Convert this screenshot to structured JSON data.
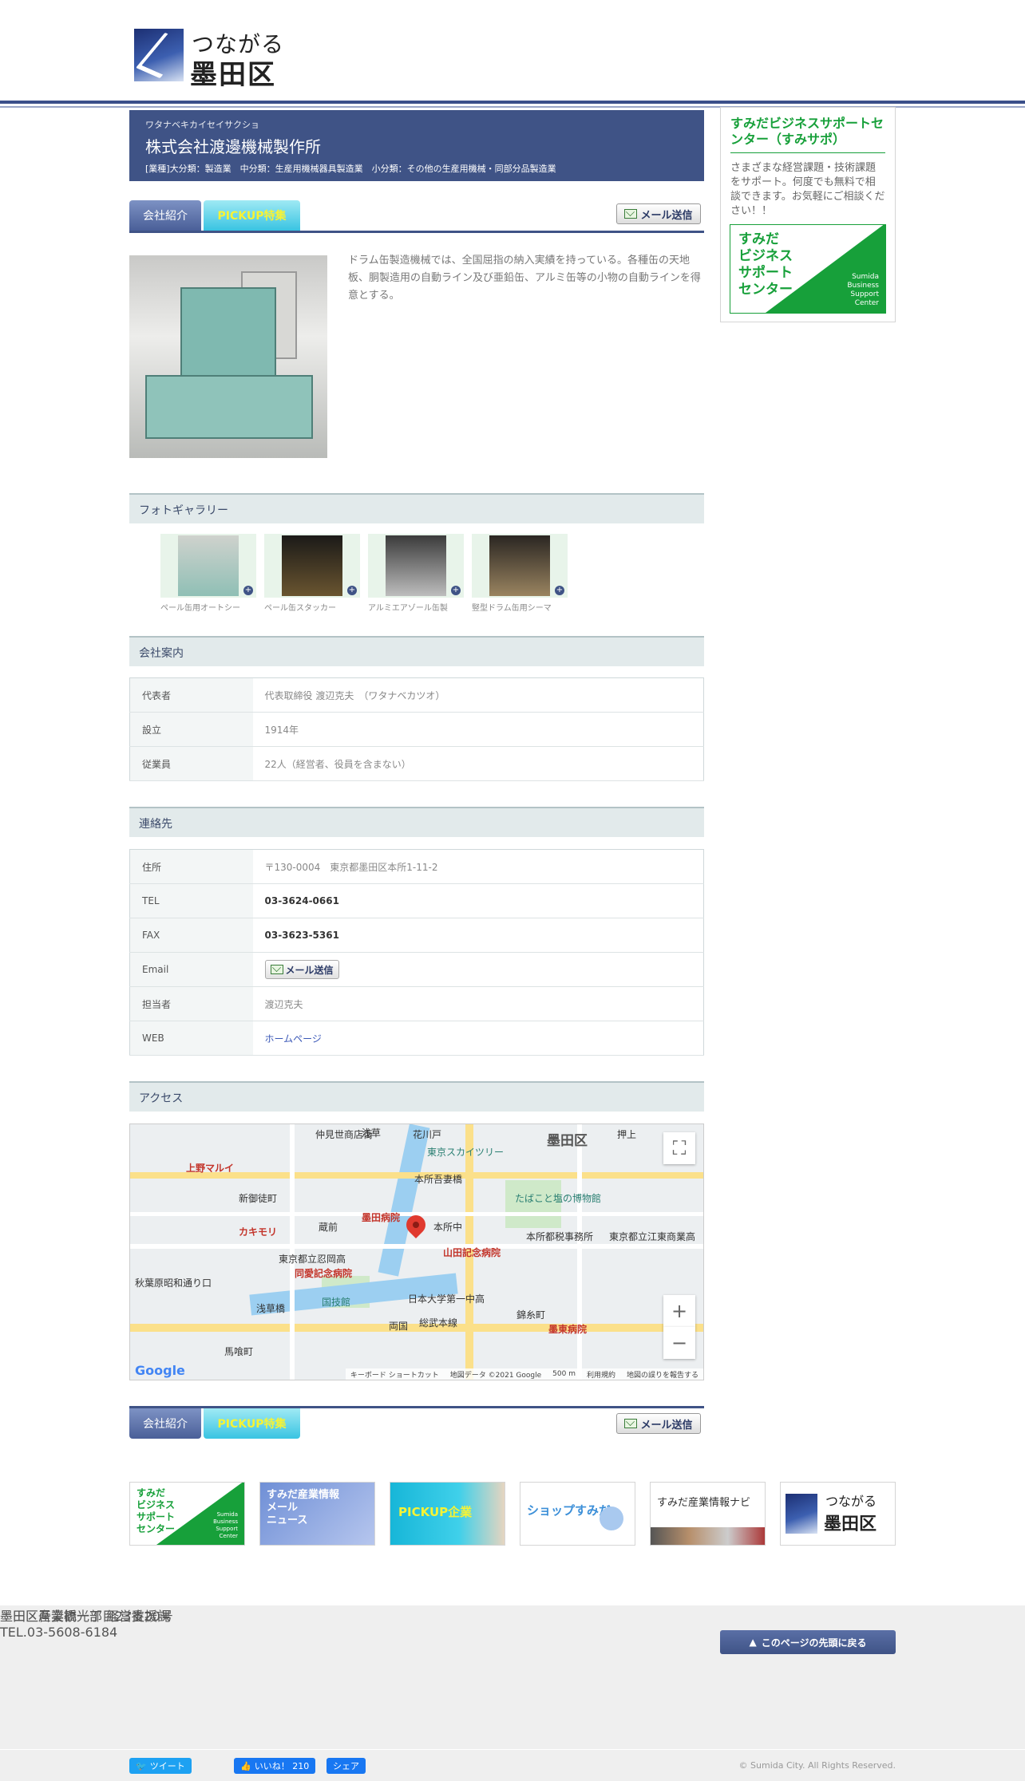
{
  "header": {
    "logo_line1": "つながる",
    "logo_line2": "墨田区"
  },
  "company": {
    "kana": "ワタナベキカイセイサクショ",
    "name": "株式会社渡邊機械製作所",
    "industry": "[業種]大分類：製造業　中分類：生産用機械器具製造業　小分類：その他の生産用機械・同部分品製造業"
  },
  "tabs": {
    "intro": "会社紹介",
    "pickup": "PICKUP特集",
    "mail": "メール送信"
  },
  "intro_text": "ドラム缶製造機械では、全国屈指の納入実績を持っている。各種缶の天地板、胴製造用の自動ライン及び亜鉛缶、アルミ缶等の小物の自動ラインを得意とする。",
  "sections": {
    "gallery": "フォトギャラリー",
    "company": "会社案内",
    "contact": "連絡先",
    "access": "アクセス"
  },
  "gallery": [
    {
      "caption": "ペール缶用オートシー"
    },
    {
      "caption": "ペール缶スタッカー"
    },
    {
      "caption": "アルミエアゾール缶製"
    },
    {
      "caption": "竪型ドラム缶用シーマ"
    }
  ],
  "company_info": [
    {
      "key": "代表者",
      "value": "代表取締役 渡辺克夫　（ワタナベカツオ）"
    },
    {
      "key": "設立",
      "value": "1914年"
    },
    {
      "key": "従業員",
      "value": "22人（経営者、役員を含まない）"
    }
  ],
  "contact_info": {
    "address_key": "住所",
    "address": "〒130-0004　東京都墨田区本所1-11-2",
    "tel_key": "TEL",
    "tel": "03-3624-0661",
    "fax_key": "FAX",
    "fax": "03-3623-5361",
    "email_key": "Email",
    "email_button": "メール送信",
    "person_key": "担当者",
    "person": "渡辺克夫",
    "web_key": "WEB",
    "web": "ホームページ"
  },
  "map": {
    "labels": {
      "ward": "墨田区",
      "skytree": "東京スカイツリー",
      "tobacco": "たばこと塩の博物館",
      "sumida_hospital": "墨田病院",
      "yamada": "山田記念病院",
      "honjo": "本所中",
      "doai": "同愛記念病院",
      "kokugikan": "国技館",
      "asakusa": "浅草",
      "ryogoku": "両国",
      "sobu": "総武本線",
      "nichidai": "日本大学第一中高",
      "bokuto": "墨東病院",
      "kachimairi": "カキモリ",
      "ueno": "上野マルイ",
      "akiba": "秋葉原昭和通り口",
      "okachimachi": "御徒町",
      "shinokachimachi": "新御徒町",
      "kuramae": "蔵前",
      "asakusabashi": "浅草橋",
      "bakurocho": "馬喰町",
      "honjoazumabashi": "本所吾妻橋",
      "oshiage": "押上",
      "kinshicho": "錦糸町",
      "nakamise": "仲見世商店街",
      "hanakawado": "花川戸",
      "ryogoku_fire": "東京都立忍岡高",
      "kyodo": "本所都税事務所",
      "tokyo_ritsu": "東京都立江東商業高"
    },
    "google": "Google",
    "attribution": [
      "キーボード ショートカット",
      "地図データ ©2021 Google",
      "500 m",
      "利用規約",
      "地図の誤りを報告する"
    ]
  },
  "sidebar": {
    "title": "すみだビジネスサポートセンター（すみサポ）",
    "desc": "さまざまな経営課題・技術課題をサポート。何度でも無料で相談できます。お気軽にご相談ください！！",
    "banner_jp": "すみだ\nビジネス\nサポート\nセンター",
    "banner_en": "Sumida\nBusiness\nSupport\nCenter"
  },
  "bottom_banners": [
    {
      "jp": "すみだ\nビジネス\nサポート\nセンター",
      "en": "Sumida\nBusiness\nSupport\nCenter"
    },
    {
      "text": "すみだ産業情報\nメール\nニュース"
    },
    {
      "text": "PICKUP企業"
    },
    {
      "text": "ショップすみだ"
    },
    {
      "text": "すみだ産業情報ナビ"
    },
    {
      "line1": "つながる",
      "line2": "墨田区"
    }
  ],
  "footer": {
    "back_top": "このページの先頭に戻る",
    "dept": "墨田区産業観光部 経営支援課",
    "address": "墨田区吾妻橋一丁目23番20号",
    "tel": "TEL.03-5608-6184",
    "tweet": "ツイート",
    "like": "いいね！ 210",
    "share": "シェア",
    "copyright": "© Sumida City. All Rights Reserved."
  },
  "colors": {
    "brand": "#3f5386",
    "accent_green": "#17a03a",
    "pickup": "#39c4e2"
  }
}
